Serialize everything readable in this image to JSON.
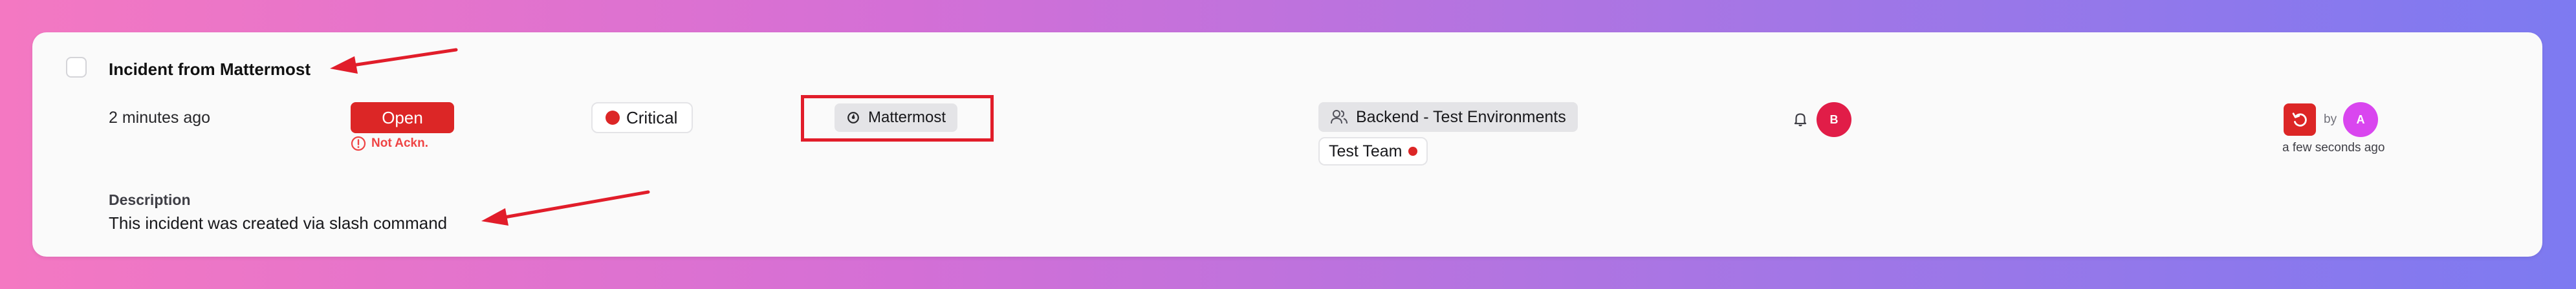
{
  "incident": {
    "title": "Incident from Mattermost",
    "time_ago": "2 minutes ago",
    "status": "Open",
    "ack_status": "Not Ackn.",
    "severity": "Critical",
    "source": "Mattermost",
    "teams": [
      "Backend - Test Environments",
      "Test Team"
    ],
    "assignee_initial": "B",
    "action_by_label": "by",
    "action_user_initial": "A",
    "action_time": "a few seconds ago",
    "description_label": "Description",
    "description": "This incident was created via slash command"
  },
  "colors": {
    "critical": "#dc2626",
    "annotation": "#e11d2a",
    "avatar_b": "#e11d48",
    "avatar_a": "#d946ef"
  },
  "icons": {
    "ack": "alert-circle-icon",
    "source": "mattermost-icon",
    "team": "users-icon",
    "notify": "bell-icon",
    "reopen": "reopen-icon"
  }
}
